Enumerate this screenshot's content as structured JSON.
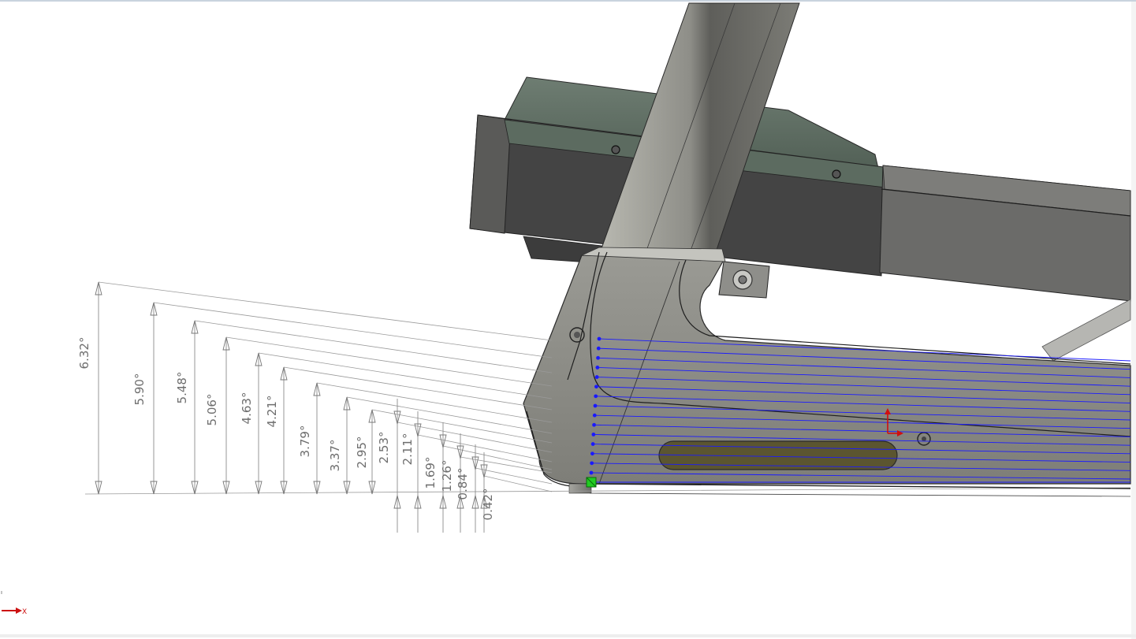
{
  "viewport": {
    "axis_label_x": "X"
  },
  "dimensions": {
    "angles": [
      "6.32°",
      "5.90°",
      "5.48°",
      "5.06°",
      "4.63°",
      "4.21°",
      "3.79°",
      "3.37°",
      "2.95°",
      "2.53°",
      "2.11°",
      "1.69°",
      "1.26°",
      "0.84°",
      "0.42°"
    ]
  },
  "colors": {
    "sketch": "#1a1aff",
    "frame_light": "#9e9e98",
    "frame_dark": "#4a4a48",
    "console_green": "#4f5f55",
    "slot": "#5b5530",
    "origin_marker": "#22cc22"
  }
}
